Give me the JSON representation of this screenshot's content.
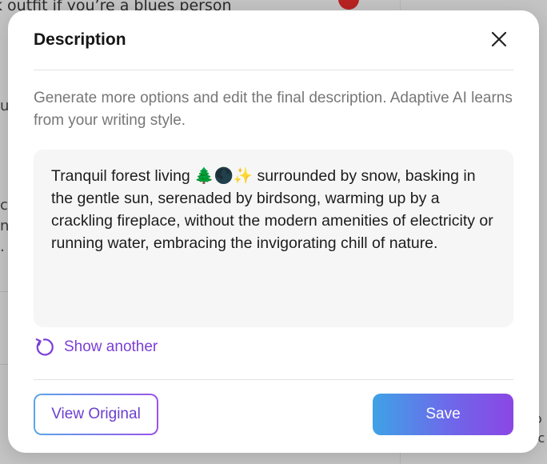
{
  "background": {
    "top_text": "k outfit if you’re a blues person",
    "left_fragments": [
      "u",
      "c",
      "n",
      "."
    ],
    "right_fragments": [
      "l",
      "o",
      "ic"
    ]
  },
  "modal": {
    "title": "Description",
    "close_icon": "close-icon",
    "intro": "Generate more options and edit the final description. Adaptive AI learns from your writing style.",
    "description": "Tranquil forest living 🌲🌑✨ surrounded by snow, basking in the gentle sun, serenaded by birdsong, warming up by a crackling fireplace, without the modern amenities of electricity or running water, embracing the invigorating chill of nature.",
    "show_another_label": "Show another",
    "show_another_icon": "refresh-icon",
    "view_original_label": "View Original",
    "save_label": "Save"
  },
  "colors": {
    "accent": "#7a3fd6",
    "save_gradient_start": "#3fa2e6",
    "save_gradient_end": "#8b46e4",
    "badge": "#b82222"
  }
}
